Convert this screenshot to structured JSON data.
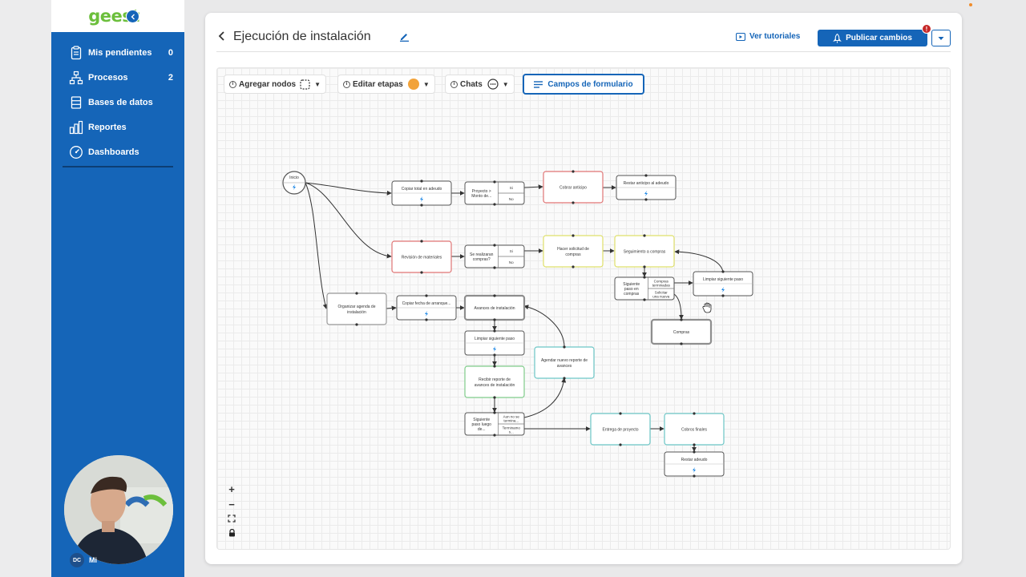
{
  "app": {
    "logo": "geest"
  },
  "sidebar": {
    "items": [
      {
        "label": "Mis pendientes",
        "count": "0",
        "icon": "clipboard-icon"
      },
      {
        "label": "Procesos",
        "count": "2",
        "icon": "sitemap-icon"
      },
      {
        "label": "Bases de datos",
        "count": "",
        "icon": "database-icon"
      },
      {
        "label": "Reportes",
        "count": "",
        "icon": "bar-chart-icon"
      },
      {
        "label": "Dashboards",
        "count": "",
        "icon": "gauge-icon"
      }
    ],
    "user_initials": "DC",
    "user_name": "Mi"
  },
  "header": {
    "title": "Ejecución de instalación",
    "tutorials_label": "Ver tutoriales",
    "publish_label": "Publicar cambios",
    "publish_badge": "!"
  },
  "toolbar": {
    "add_nodes": "Agregar nodos",
    "edit_stages": "Editar etapas",
    "chats": "Chats",
    "form_fields": "Campos de formulario"
  },
  "zoom_controls": {
    "zoom_in": "+",
    "zoom_out": "−"
  },
  "colors": {
    "brand_blue": "#1565b8",
    "logo_green": "#6cbf3c",
    "stage_red": "#e07575",
    "stage_yellow": "#dfe06a",
    "stage_teal": "#6cc6c6",
    "stage_green": "#7fcc8a",
    "stage_orange": "#f2a33a"
  },
  "flow": {
    "start_label": "Inicio",
    "nodes": [
      {
        "id": "n1",
        "title": "Copiar total en adeudo",
        "kind": "action"
      },
      {
        "id": "n2",
        "title": "Proyecto > Monto de...",
        "kind": "decision",
        "options": [
          "Si",
          "No"
        ]
      },
      {
        "id": "n3",
        "title": "Cobrar anticipo",
        "kind": "stage",
        "stage": "red"
      },
      {
        "id": "n4",
        "title": "Restar anticipo al adeudo",
        "kind": "action"
      },
      {
        "id": "n5",
        "title": "Revisión de materiales",
        "kind": "stage",
        "stage": "red"
      },
      {
        "id": "n6",
        "title": "Se realizaran compras?",
        "kind": "decision",
        "options": [
          "Si",
          "No"
        ]
      },
      {
        "id": "n7",
        "title": "Hacer solicitud de compras",
        "kind": "stage",
        "stage": "yellow"
      },
      {
        "id": "n8",
        "title": "Seguimiento a compras",
        "kind": "stage",
        "stage": "yellow"
      },
      {
        "id": "n9",
        "title": "Siguiente paso en compras",
        "kind": "decision",
        "options": [
          "Compras terminadas",
          "Solicitar una nueva"
        ]
      },
      {
        "id": "n10",
        "title": "Limpiar siguiente paso",
        "kind": "action"
      },
      {
        "id": "n11",
        "title": "Compras",
        "kind": "stage",
        "stage": "gray"
      },
      {
        "id": "n12",
        "title": "Organizar agenda de instalación",
        "kind": "stage",
        "stage": "plain"
      },
      {
        "id": "n13",
        "title": "Copiar fecha de arranque...",
        "kind": "action"
      },
      {
        "id": "n14",
        "title": "Avances de instalación",
        "kind": "stage",
        "stage": "gray"
      },
      {
        "id": "n15",
        "title": "Limpiar siguiente paso",
        "kind": "action"
      },
      {
        "id": "n16",
        "title": "Agendar nuevo reporte de avances",
        "kind": "stage",
        "stage": "teal"
      },
      {
        "id": "n17",
        "title": "Recibir reporte de avances de instalación",
        "kind": "stage",
        "stage": "green"
      },
      {
        "id": "n18",
        "title": "Siguiente paso luego de...",
        "kind": "decision",
        "options": [
          "Aun no se termina...",
          "Terminamo s..."
        ]
      },
      {
        "id": "n19",
        "title": "Entrega de proyecto",
        "kind": "stage",
        "stage": "teal"
      },
      {
        "id": "n20",
        "title": "Cobros finales",
        "kind": "stage",
        "stage": "teal"
      },
      {
        "id": "n21",
        "title": "Restar adeudo",
        "kind": "action"
      }
    ]
  }
}
